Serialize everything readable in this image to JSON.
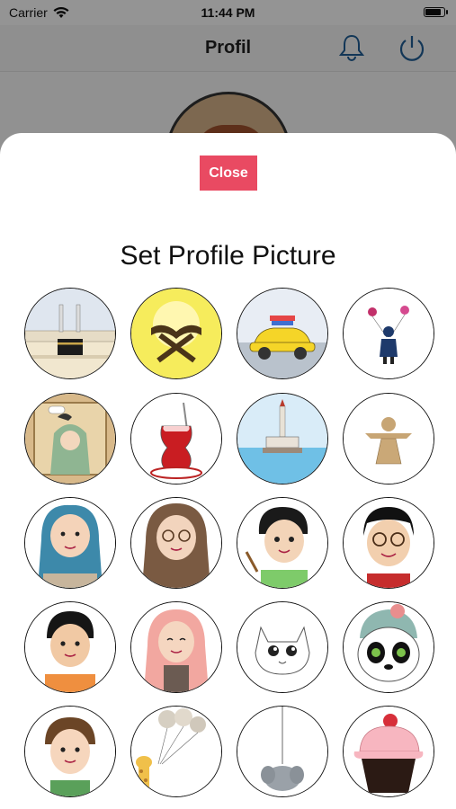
{
  "status_bar": {
    "carrier": "Carrier",
    "time": "11:44 PM"
  },
  "nav": {
    "title": "Profil"
  },
  "modal": {
    "close_label": "Close",
    "title": "Set Profile Picture"
  },
  "avatars": [
    {
      "name": "kaaba"
    },
    {
      "name": "quran-stand"
    },
    {
      "name": "yellow-car"
    },
    {
      "name": "girl-balloons"
    },
    {
      "name": "girl-window"
    },
    {
      "name": "turkish-tea"
    },
    {
      "name": "maiden-tower"
    },
    {
      "name": "straw-doll"
    },
    {
      "name": "girl-blue-hijab"
    },
    {
      "name": "woman-glasses-hijab"
    },
    {
      "name": "boy-painting"
    },
    {
      "name": "man-glasses"
    },
    {
      "name": "boy-orange-shirt"
    },
    {
      "name": "girl-pink-hijab"
    },
    {
      "name": "white-cat"
    },
    {
      "name": "panda-beanie"
    },
    {
      "name": "boy-smiling"
    },
    {
      "name": "giraffe-balloons"
    },
    {
      "name": "elephant-balloon"
    },
    {
      "name": "cupcake"
    }
  ],
  "colors": {
    "accent": "#e94a62",
    "nav_icon": "#1f5e96"
  }
}
